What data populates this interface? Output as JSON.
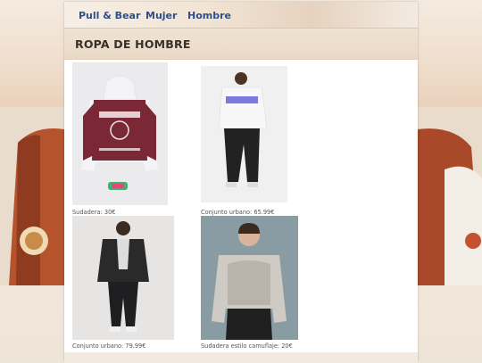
{
  "nav": {
    "items": [
      {
        "label": "Pull & Bear"
      },
      {
        "label": "Mujer"
      },
      {
        "label": "Hombre"
      }
    ]
  },
  "page_title": "ROPA DE HOMBRE",
  "products": [
    {
      "caption": "Sudadera: 30€",
      "image": "maroon-harvard-hoodie"
    },
    {
      "caption": "Conjunto urbano: 65.99€",
      "image": "white-concept-hoodie-outfit"
    },
    {
      "caption": "Conjunto urbano: 79.99€",
      "image": "black-leather-jacket-outfit"
    },
    {
      "caption": "Sudadera estilo camuflaje: 20€",
      "image": "grey-camo-sweatshirt"
    }
  ],
  "colors": {
    "nav_link": "#2f4f8a",
    "hoodie": "#7b2836",
    "page_bg": "#ffffff"
  }
}
